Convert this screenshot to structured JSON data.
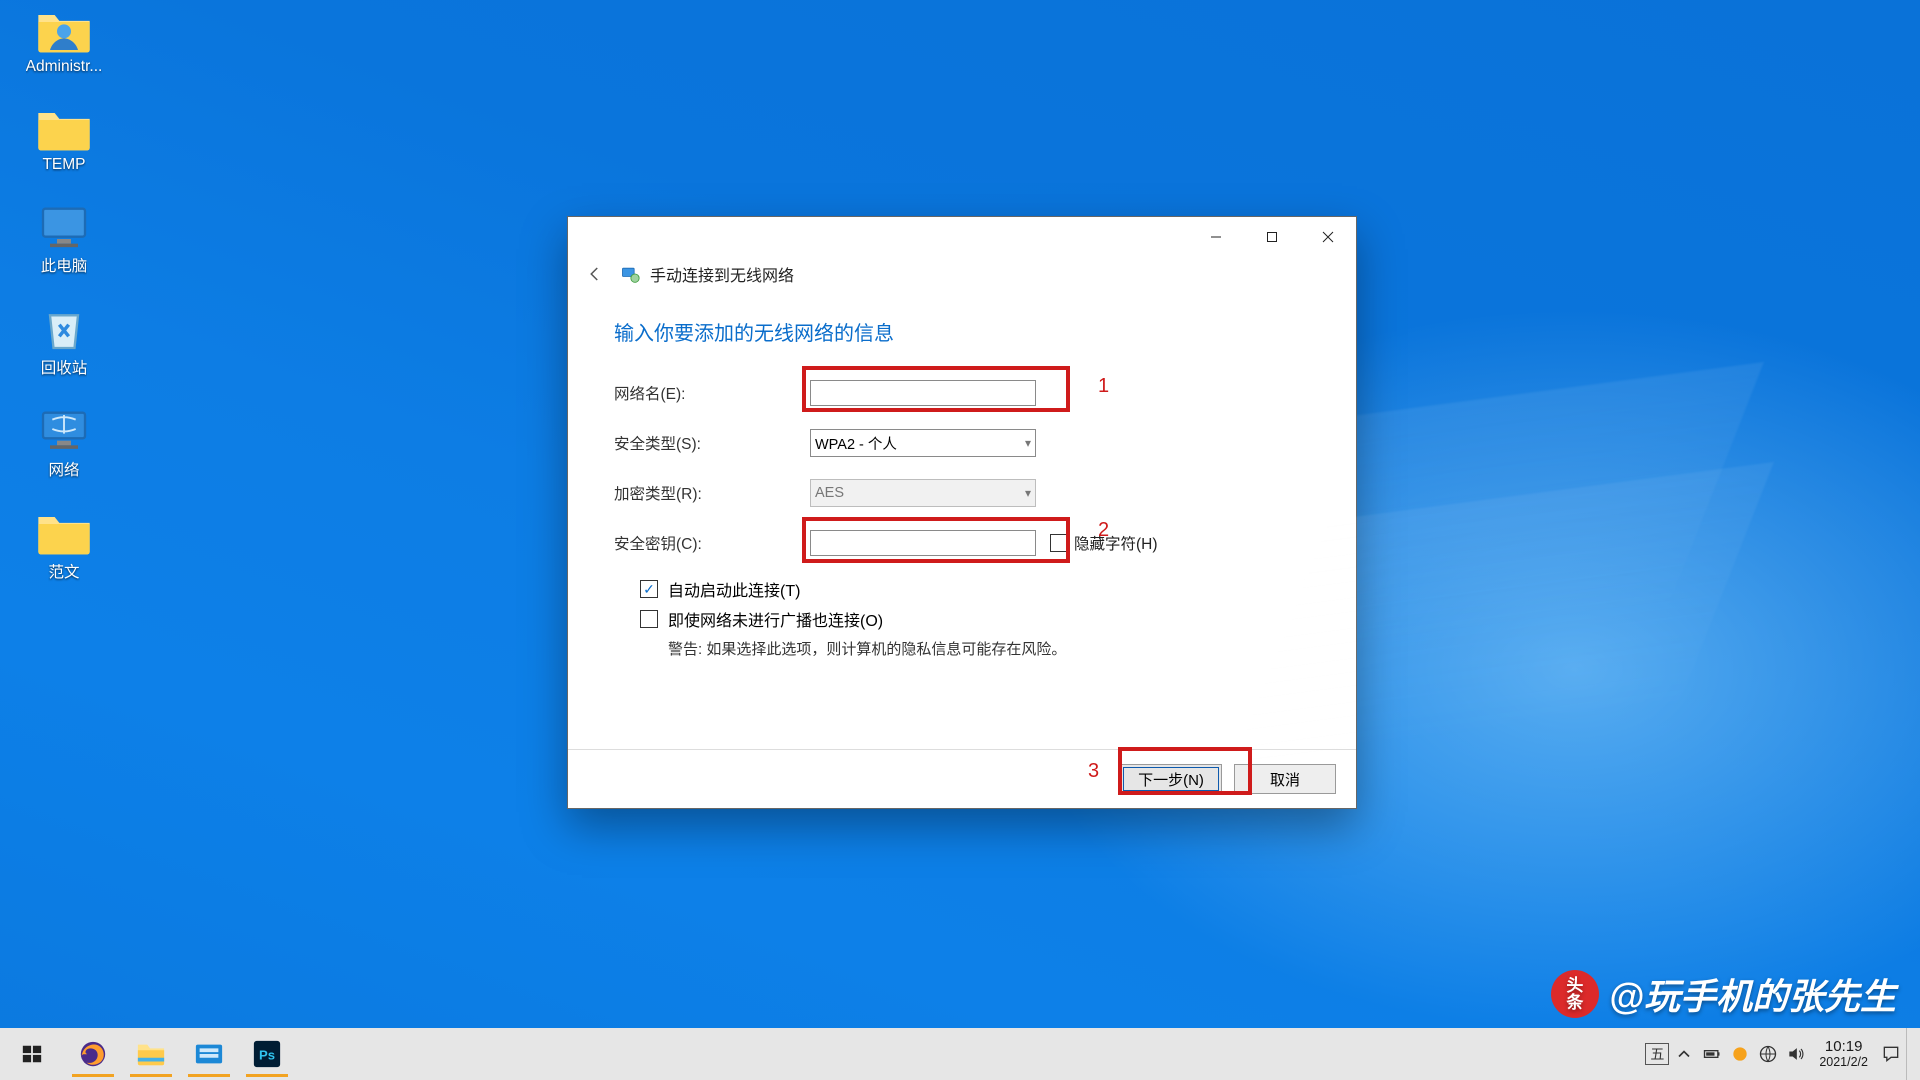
{
  "desktop_icons": [
    {
      "name": "administrator-icon",
      "label": "Administr..."
    },
    {
      "name": "temp-folder-icon",
      "label": "TEMP"
    },
    {
      "name": "this-pc-icon",
      "label": "此电脑"
    },
    {
      "name": "recycle-bin-icon",
      "label": "回收站"
    },
    {
      "name": "network-icon",
      "label": "网络"
    },
    {
      "name": "fanwen-folder-icon",
      "label": "范文"
    }
  ],
  "dialog": {
    "crumb": "手动连接到无线网络",
    "heading": "输入你要添加的无线网络的信息",
    "labels": {
      "network_name": "网络名(E):",
      "security_type": "安全类型(S):",
      "encryption_type": "加密类型(R):",
      "security_key": "安全密钥(C):"
    },
    "values": {
      "network_name": "",
      "security_type": "WPA2 - 个人",
      "encryption_type": "AES",
      "security_key": ""
    },
    "hide_chars_label": "隐藏字符(H)",
    "auto_start_label": "自动启动此连接(T)",
    "connect_even_hidden_label": "即使网络未进行广播也连接(O)",
    "warning": "警告: 如果选择此选项，则计算机的隐私信息可能存在风险。",
    "buttons": {
      "next": "下一步(N)",
      "cancel": "取消"
    },
    "checkboxes": {
      "auto_start": true,
      "connect_hidden": false,
      "hide_chars": false
    }
  },
  "annotations": {
    "n1": "1",
    "n2": "2",
    "n3": "3"
  },
  "tray": {
    "ime": "五",
    "time": "10:19",
    "date": "2021/2/2"
  },
  "watermark": {
    "badge_top": "头",
    "badge_bot": "条",
    "text": "@玩手机的张先生"
  }
}
